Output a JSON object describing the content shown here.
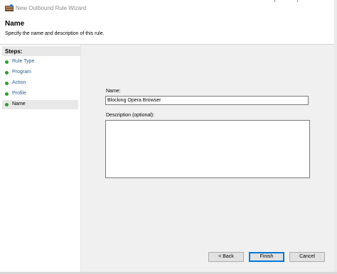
{
  "window": {
    "title": "New Outbound Rule Wizard",
    "icon": "firewall-wizard-icon"
  },
  "header": {
    "title": "Name",
    "subtitle": "Specify the name and description of this rule."
  },
  "steps": {
    "heading": "Steps:",
    "items": [
      {
        "label": "Rule Type"
      },
      {
        "label": "Program"
      },
      {
        "label": "Action"
      },
      {
        "label": "Profile"
      },
      {
        "label": "Name",
        "current": true
      }
    ]
  },
  "form": {
    "name_label": "Name:",
    "name_value": "Blocking Opera Browser",
    "description_label": "Description (optional):",
    "description_value": ""
  },
  "buttons": {
    "back": "< Back",
    "finish": "Finish",
    "cancel": "Cancel"
  },
  "colors": {
    "step_link": "#2e5e8e",
    "step_dot": "#2f9e2f",
    "focus_border": "#0078d7"
  }
}
